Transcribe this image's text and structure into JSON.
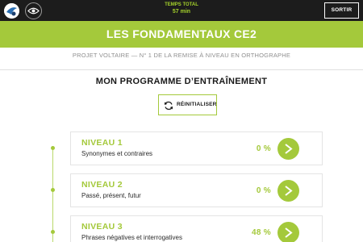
{
  "topbar": {
    "logo_icon": "app-logo-icon",
    "visibility_icon": "eye-icon",
    "time_label": "TEMPS TOTAL",
    "time_value": "57 min",
    "quit_label": "SORTIR"
  },
  "header": {
    "title": "LES FONDAMENTAUX CE2",
    "subtitle": "PROJET VOLTAIRE — N° 1 DE LA REMISE À NIVEAU EN ORTHOGRAPHE"
  },
  "program": {
    "title": "MON PROGRAMME D’ENTRAÎNEMENT",
    "reset_label": "RÉINITIALISER",
    "reset_icon": "refresh-icon"
  },
  "levels": [
    {
      "name": "NIVEAU 1",
      "description": "Synonymes et contraires",
      "percent": "0 %"
    },
    {
      "name": "NIVEAU 2",
      "description": "Passé, présent, futur",
      "percent": "0 %"
    },
    {
      "name": "NIVEAU 3",
      "description": "Phrases négatives et interrogatives",
      "percent": "48 %"
    }
  ],
  "colors": {
    "accent": "#a4c93b",
    "topbar": "#1c1c1c"
  }
}
